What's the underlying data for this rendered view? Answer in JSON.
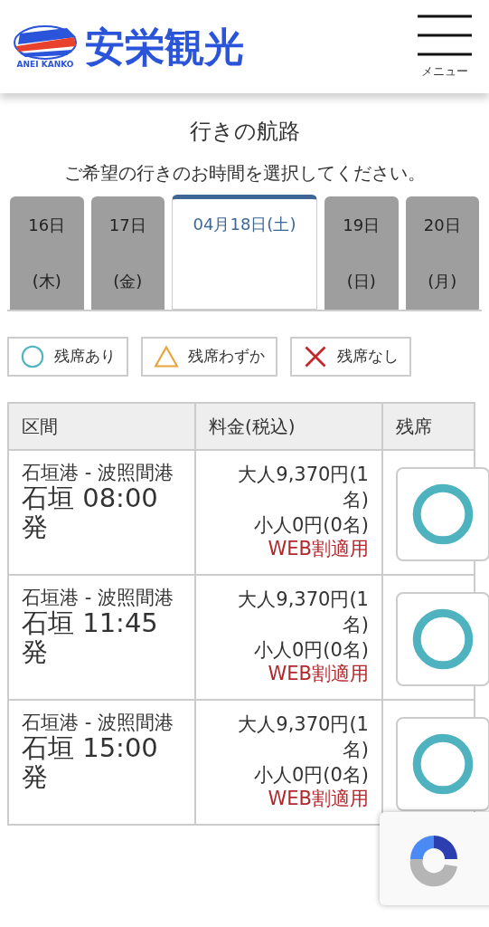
{
  "header": {
    "logo_text": "ANEI KANKO",
    "brand": "安栄観光",
    "menu_label": "メニュー"
  },
  "title": "行きの航路",
  "instruction": "ご希望の行きのお時間を選択してください。",
  "date_tabs": [
    {
      "day": "16日",
      "weekday": "(木)",
      "selected": false
    },
    {
      "day": "17日",
      "weekday": "(金)",
      "selected": false
    },
    {
      "day": "04月18日(土)",
      "selected": true
    },
    {
      "day": "19日",
      "weekday": "(日)",
      "selected": false
    },
    {
      "day": "20日",
      "weekday": "(月)",
      "selected": false
    }
  ],
  "legend": [
    {
      "kind": "available",
      "label": "残席あり"
    },
    {
      "kind": "few",
      "label": "残席わずか"
    },
    {
      "kind": "none",
      "label": "残席なし"
    }
  ],
  "table": {
    "columns": [
      "区間",
      "料金(税込)",
      "残席"
    ],
    "rows": [
      {
        "route": "石垣港 - 波照間港",
        "departure": "石垣 08:00発",
        "adult": "大人9,370円(1名)",
        "child": "小人0円(0名)",
        "discount": "WEB割適用",
        "kind": "available"
      },
      {
        "route": "石垣港 - 波照間港",
        "departure": "石垣 11:45発",
        "adult": "大人9,370円(1名)",
        "child": "小人0円(0名)",
        "discount": "WEB割適用",
        "kind": "available"
      },
      {
        "route": "石垣港 - 波照間港",
        "departure": "石垣 15:00発",
        "adult": "大人9,370円(1名)",
        "child": "小人0円(0名)",
        "discount": "WEB割適用",
        "kind": "available"
      }
    ]
  }
}
